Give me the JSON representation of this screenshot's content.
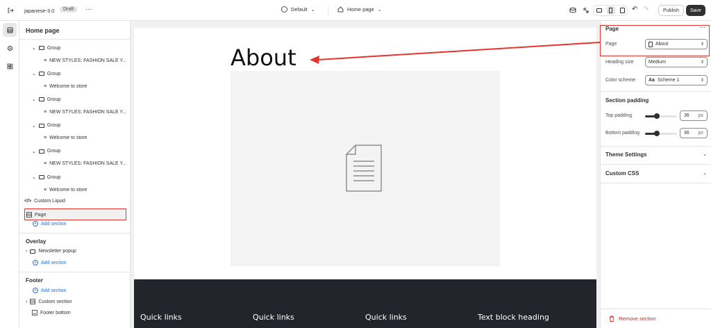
{
  "topbar": {
    "store_name": "japanese-3.0",
    "status_badge": "Draft",
    "theme_select": "Default",
    "page_select": "Home page",
    "publish_label": "Publish",
    "save_label": "Save"
  },
  "left": {
    "title": "Home page",
    "tree": [
      {
        "label": "Group",
        "type": "group"
      },
      {
        "label": "NEW STYLES: FASHION SALE Y...",
        "type": "text"
      },
      {
        "label": "Group",
        "type": "group"
      },
      {
        "label": "Welcome to store",
        "type": "text"
      },
      {
        "label": "Group",
        "type": "group"
      },
      {
        "label": "NEW STYLES: FASHION SALE Y...",
        "type": "text"
      },
      {
        "label": "Group",
        "type": "group"
      },
      {
        "label": "Welcome to store",
        "type": "text"
      },
      {
        "label": "Group",
        "type": "group"
      },
      {
        "label": "NEW STYLES: FASHION SALE Y...",
        "type": "text"
      },
      {
        "label": "Group",
        "type": "group"
      },
      {
        "label": "Welcome to store",
        "type": "text"
      }
    ],
    "custom_liquid": "Custom Liquid",
    "page_item": "Page",
    "add_section": "Add section",
    "overlay_title": "Overlay",
    "newsletter": "Newsletter popup",
    "overlay_add": "Add section",
    "footer_title": "Footer",
    "footer_add": "Add section",
    "custom_section": "Custom section",
    "footer_bottom": "Footer bottom"
  },
  "canvas": {
    "heading": "About",
    "footer_cols": [
      "Quick links",
      "Quick links",
      "Quick links",
      "Text block heading"
    ]
  },
  "right": {
    "section_title": "Page",
    "page_label": "Page",
    "page_value": "About",
    "heading_size_label": "Heading size",
    "heading_size_value": "Medium",
    "color_scheme_label": "Color scheme",
    "color_scheme_value": "Scheme 1",
    "padding_title": "Section padding",
    "top_padding_label": "Top padding",
    "top_padding_value": "36",
    "bottom_padding_label": "Bottom padding",
    "bottom_padding_value": "36",
    "unit": "px",
    "theme_settings": "Theme Settings",
    "custom_css": "Custom CSS",
    "remove_section": "Remove section"
  },
  "colors": {
    "annotation_red": "#e4342c",
    "footer_dark": "#23252c",
    "remove_red": "#c5281c"
  }
}
